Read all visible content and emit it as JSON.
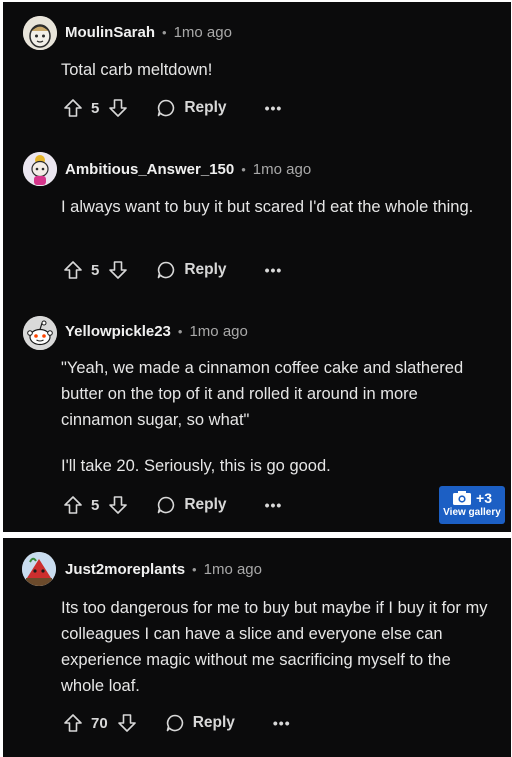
{
  "comments": [
    {
      "username": "MoulinSarah",
      "time": "1mo ago",
      "paragraphs": [
        "Total carb meltdown!"
      ],
      "votes": "5",
      "reply_label": "Reply",
      "more_label": "•••"
    },
    {
      "username": "Ambitious_Answer_150",
      "time": "1mo ago",
      "paragraphs": [
        "I always want to buy it but scared I'd eat the whole thing."
      ],
      "votes": "5",
      "reply_label": "Reply",
      "more_label": "•••"
    },
    {
      "username": "Yellowpickle23",
      "time": "1mo ago",
      "paragraphs": [
        "\"Yeah, we made a cinnamon coffee cake and slathered butter on the top of it and rolled it around in more cinnamon sugar, so what\"",
        "I'll take 20. Seriously, this is go good."
      ],
      "votes": "5",
      "reply_label": "Reply",
      "more_label": "•••",
      "gallery": {
        "count": "+3",
        "label": "View gallery"
      }
    },
    {
      "username": "Just2moreplants",
      "time": "1mo ago",
      "paragraphs": [
        "Its too dangerous for me to buy but maybe if I buy it for my colleagues I can have a slice and everyone else can experience magic without me sacrificing myself to the whole loaf."
      ],
      "votes": "70",
      "reply_label": "Reply",
      "more_label": "•••"
    }
  ],
  "colors": {
    "background": "#0b0b0c",
    "text": "#e6e6e6",
    "gallery_button": "#1c5fc4"
  },
  "icons": [
    "upvote-icon",
    "downvote-icon",
    "comment-bubble-icon",
    "camera-icon"
  ]
}
